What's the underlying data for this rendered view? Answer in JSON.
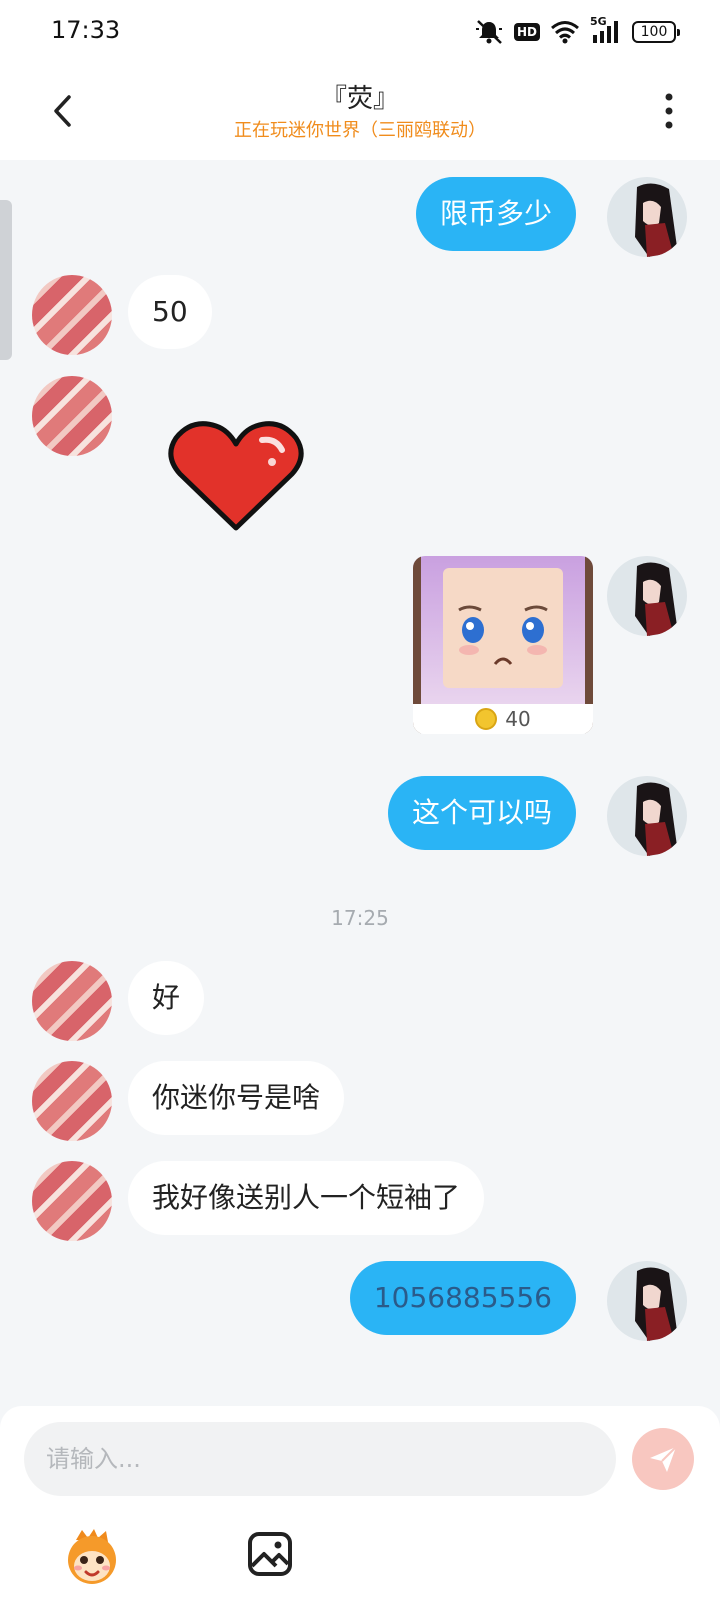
{
  "status_bar": {
    "time": "17:33",
    "hd_label": "HD",
    "network_label": "5G",
    "battery": "100",
    "icons": [
      "mute-bell-icon",
      "hd-icon",
      "wifi-icon",
      "signal-5g-icon",
      "battery-icon"
    ]
  },
  "header": {
    "title": "『荧』",
    "subtitle": "正在玩迷你世界（三丽鸥联动）",
    "back_icon": "chevron-left-icon",
    "more_icon": "more-vertical-icon",
    "subtitle_color": "#f08c1c"
  },
  "messages": [
    {
      "side": "out",
      "type": "text",
      "text": "限币多少"
    },
    {
      "side": "in",
      "type": "text",
      "text": "50"
    },
    {
      "side": "in",
      "type": "sticker",
      "sticker": "heart-sticker"
    },
    {
      "side": "out",
      "type": "item_card",
      "price": "40"
    },
    {
      "side": "out",
      "type": "text",
      "text": "这个可以吗"
    },
    {
      "type": "time",
      "text": "17:25"
    },
    {
      "side": "in",
      "type": "text",
      "text": "好"
    },
    {
      "side": "in",
      "type": "text",
      "text": "你迷你号是啥"
    },
    {
      "side": "in",
      "type": "text",
      "text": "我好像送别人一个短袖了"
    },
    {
      "side": "out",
      "type": "text",
      "text": "1056885556"
    }
  ],
  "input": {
    "placeholder": "请输入..."
  },
  "toolbar": {
    "buttons": [
      "mascot-emoji-icon",
      "image-icon"
    ]
  },
  "colors": {
    "outgoing_bubble": "#2ab4f5",
    "incoming_bubble": "#ffffff",
    "background": "#f4f6f8",
    "send_button": "#f8c7c0"
  }
}
